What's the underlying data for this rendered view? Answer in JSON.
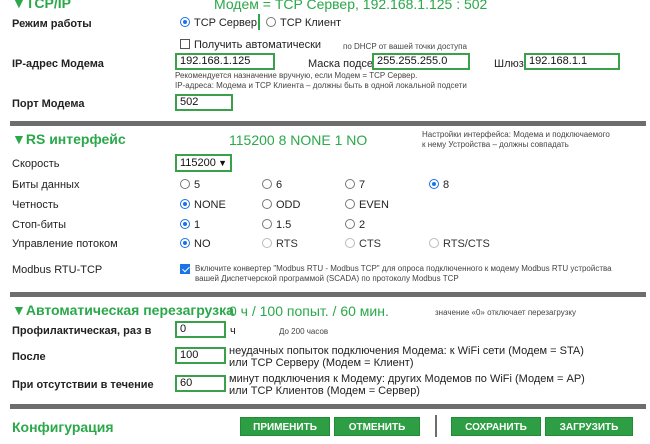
{
  "tcp": {
    "title": "▼TCP/IP",
    "info": "Модем = TCP Сервер, 192.168.1.125 : 502",
    "mode_label": "Режим работы",
    "mode_server": "TCP Сервер",
    "mode_client": "TCP Клиент",
    "auto_label": "Получить автоматически",
    "auto_hint": "по DHCP от вашей точки доступа",
    "ip_label": "IP-адрес Модема",
    "ip_value": "192.168.1.125",
    "mask_label": "Маска подсети",
    "mask_value": "255.255.255.0",
    "gw_label": "Шлюз",
    "gw_value": "192.168.1.1",
    "note1": "Рекомендуется назначение вручную, если Модем = TCP Сервер.",
    "note2": "IP-адреса: Модема и TCP Клиента – должны быть в одной локальной подсети",
    "port_label": "Порт Модема",
    "port_value": "502"
  },
  "rs": {
    "title": "▼RS интерфейс",
    "info": "115200 8 NONE 1 NO",
    "hint1": "Настройки интерфейса: Модема и подключаемого",
    "hint2": "к нему Устройства – должны совпадать",
    "speed_label": "Скорость",
    "speed_value": "115200",
    "bits_label": "Биты данных",
    "bits": [
      "5",
      "6",
      "7",
      "8"
    ],
    "parity_label": "Четность",
    "parity": [
      "NONE",
      "ODD",
      "EVEN"
    ],
    "stop_label": "Стоп-биты",
    "stop": [
      "1",
      "1.5",
      "2"
    ],
    "flow_label": "Управление потоком",
    "flow": [
      "NO",
      "RTS",
      "CTS",
      "RTS/CTS"
    ],
    "modbus_label": "Modbus RTU-TCP",
    "modbus_text1": "Включите конвертер \"Modbus RTU - Modbus TCP\" для опроса подключенного к модему Modbus RTU устройства",
    "modbus_text2": "вашей Диспетчерской программой (SCADA) по протоколу Modbus TCP"
  },
  "reboot": {
    "title": "▼Автоматическая перезагрузка",
    "info": "0 ч / 100 попыт. / 60 мин.",
    "hint": "значение «0» отключает перезагрузку",
    "prof_label": "Профилактическая, раз в",
    "prof_value": "0",
    "prof_unit": "ч",
    "prof_hint": "До 200 часов",
    "after_label": "После",
    "after_value": "100",
    "after_text1": "неудачных попыток подключения Модема: к WiFi сети (Модем = STA)",
    "after_text2": "или TCP Серверу (Модем = Клиент)",
    "absent_label": "При отсутствии в течение",
    "absent_value": "60",
    "absent_text1": "минут подключения к Модему: других Модемов по WiFi (Модем = AP)",
    "absent_text2": "или TCP Клиентов (Модем = Сервер)"
  },
  "footer": {
    "config_label": "Конфигурация",
    "apply": "ПРИМЕНИТЬ",
    "cancel": "ОТМЕНИТЬ",
    "save": "СОХРАНИТЬ",
    "load": "ЗАГРУЗИТЬ"
  }
}
